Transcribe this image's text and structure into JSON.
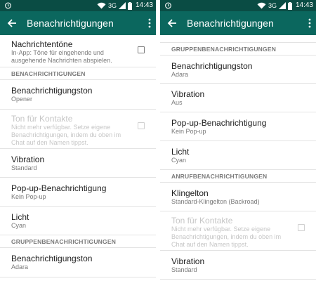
{
  "status_bar": {
    "network": "3G",
    "time": "14:43"
  },
  "appbar": {
    "title": "Benachrichtigungen"
  },
  "left": {
    "notification_sounds": {
      "title": "Nachrichtentöne",
      "subtitle": "In-App: Töne für eingehende und ausgehende Nachrichten abspielen.",
      "checked": false
    },
    "section1": "BENACHRICHTIGUNGEN",
    "items1": [
      {
        "title": "Benachrichtigungston",
        "subtitle": "Opener"
      }
    ],
    "contact_sound": {
      "title": "Ton für Kontakte",
      "subtitle": "Nicht mehr verfügbar. Setze eigene Benachrichtigungen, indem du oben im Chat auf den Namen tippst."
    },
    "items2": [
      {
        "title": "Vibration",
        "subtitle": "Standard"
      },
      {
        "title": "Pop-up-Benachrichtigung",
        "subtitle": "Kein Pop-up"
      },
      {
        "title": "Licht",
        "subtitle": "Cyan"
      }
    ],
    "section2": "GRUPPENBENACHRICHTIGUNGEN",
    "items3": [
      {
        "title": "Benachrichtigungston",
        "subtitle": "Adara"
      }
    ]
  },
  "right": {
    "section1": "GRUPPENBENACHRICHTIGUNGEN",
    "items1": [
      {
        "title": "Benachrichtigungston",
        "subtitle": "Adara"
      },
      {
        "title": "Vibration",
        "subtitle": "Aus"
      },
      {
        "title": "Pop-up-Benachrichtigung",
        "subtitle": "Kein Pop-up"
      },
      {
        "title": "Licht",
        "subtitle": "Cyan"
      }
    ],
    "section2": "ANRUFBENACHRICHTIGUNGEN",
    "items2": [
      {
        "title": "Klingelton",
        "subtitle": "Standard-Klingelton (Backroad)"
      }
    ],
    "contact_sound": {
      "title": "Ton für Kontakte",
      "subtitle": "Nicht mehr verfügbar. Setze eigene Benachrichtigungen, indem du oben im Chat auf den Namen tippst."
    },
    "items3": [
      {
        "title": "Vibration",
        "subtitle": "Standard"
      }
    ]
  },
  "colors": {
    "statusbar": "#0a4c44",
    "appbar": "#0b675e",
    "text": "#212121",
    "secondary": "#7a7a7a",
    "disabled": "#c6c6c6"
  },
  "icons": {
    "alarm": "alarm-clock-icon",
    "wifi": "wifi-icon",
    "signal": "signal-icon",
    "battery": "battery-icon",
    "back": "arrow-back-icon",
    "menu": "more-vert-icon"
  }
}
